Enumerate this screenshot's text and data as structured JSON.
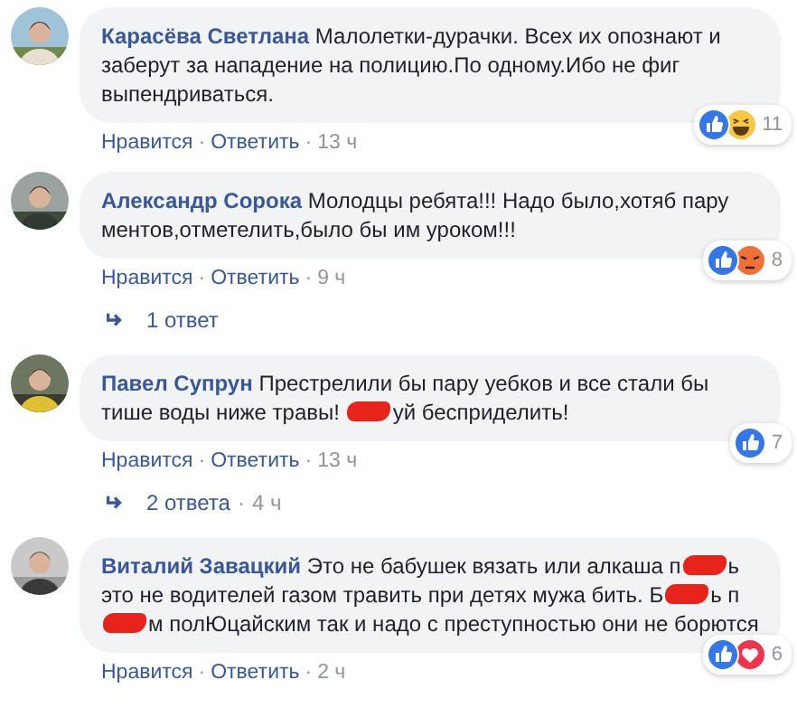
{
  "comments": [
    {
      "author": "Карасёва Светлана",
      "segments": [
        {
          "kind": "text",
          "text": "Малолетки-дурачки. Всех их опознают и заберут за нападение на полицию.По одному.Ибо не фиг выпендриваться."
        }
      ],
      "reactions": [
        {
          "kind": "like"
        },
        {
          "kind": "haha"
        }
      ],
      "reaction_count": "11",
      "meta": [
        {
          "kind": "link",
          "text": "Нравится"
        },
        {
          "kind": "separator",
          "text": "·"
        },
        {
          "kind": "link",
          "text": "Ответить"
        },
        {
          "kind": "separator",
          "text": "·"
        },
        {
          "kind": "time",
          "text": "13 ч"
        }
      ]
    },
    {
      "author": "Александр Сорока",
      "segments": [
        {
          "kind": "text",
          "text": "Молодцы ребята!!! Надо было,хотяб пару ментов,отметелить,было бы им уроком!!!"
        }
      ],
      "reactions": [
        {
          "kind": "like"
        },
        {
          "kind": "angry"
        }
      ],
      "reaction_count": "8",
      "meta": [
        {
          "kind": "link",
          "text": "Нравится"
        },
        {
          "kind": "separator",
          "text": "·"
        },
        {
          "kind": "link",
          "text": "Ответить"
        },
        {
          "kind": "separator",
          "text": "·"
        },
        {
          "kind": "time",
          "text": "9 ч"
        }
      ],
      "replies": [
        {
          "kind": "link",
          "text": "1 ответ"
        }
      ]
    },
    {
      "author": "Павел Супрун",
      "segments": [
        {
          "kind": "text",
          "text": "Престрелили бы пару уебков и все стали бы тише воды ниже травы! "
        },
        {
          "kind": "redaction"
        },
        {
          "kind": "text",
          "text": "уй бесприделить!"
        }
      ],
      "reactions": [
        {
          "kind": "like"
        }
      ],
      "reaction_count": "7",
      "meta": [
        {
          "kind": "link",
          "text": "Нравится"
        },
        {
          "kind": "separator",
          "text": "·"
        },
        {
          "kind": "link",
          "text": "Ответить"
        },
        {
          "kind": "separator",
          "text": "·"
        },
        {
          "kind": "time",
          "text": "13 ч"
        }
      ],
      "replies": [
        {
          "kind": "link",
          "text": "2 ответа"
        },
        {
          "kind": "separator",
          "text": "·"
        },
        {
          "kind": "time",
          "text": "4 ч"
        }
      ]
    },
    {
      "author": "Виталий Завацкий",
      "segments": [
        {
          "kind": "text",
          "text": "Это не бабушек вязать или алкаша п"
        },
        {
          "kind": "redaction"
        },
        {
          "kind": "text",
          "text": "ь это не водителей газом травить при детях мужа бить. Б"
        },
        {
          "kind": "redaction"
        },
        {
          "kind": "text",
          "text": "ь п"
        },
        {
          "kind": "redaction"
        },
        {
          "kind": "text",
          "text": "м полЮцайским так и надо с преступностью они не борются"
        }
      ],
      "reactions": [
        {
          "kind": "like"
        },
        {
          "kind": "love"
        }
      ],
      "reaction_count": "6",
      "meta": [
        {
          "kind": "link",
          "text": "Нравится"
        },
        {
          "kind": "separator",
          "text": "·"
        },
        {
          "kind": "link",
          "text": "Ответить"
        },
        {
          "kind": "separator",
          "text": "·"
        },
        {
          "kind": "time",
          "text": "2 ч"
        }
      ]
    }
  ]
}
